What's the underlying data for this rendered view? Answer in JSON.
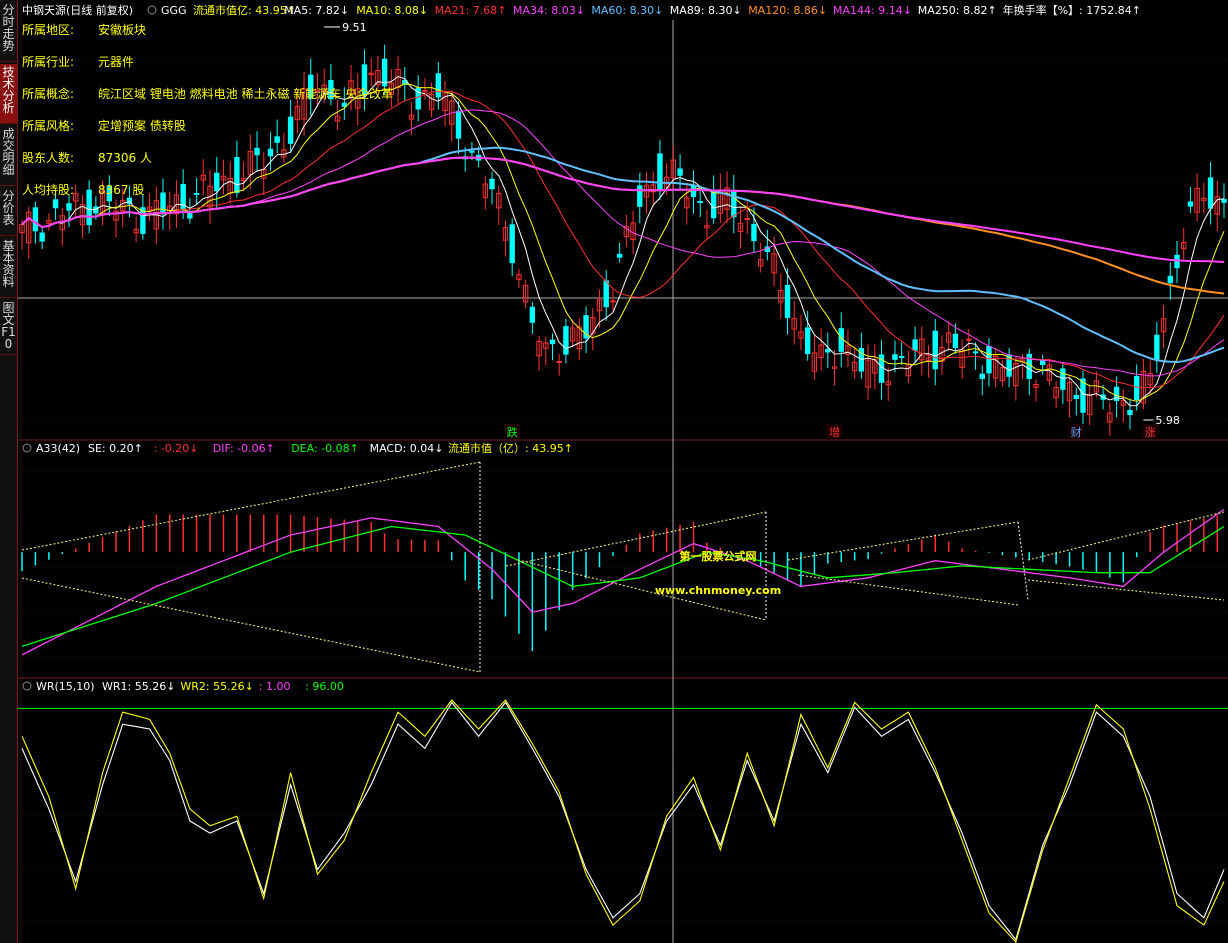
{
  "sidebar": {
    "tabs": [
      {
        "label": "分时走势",
        "active": false
      },
      {
        "label": "技术分析",
        "active": true
      },
      {
        "label": "成交明细",
        "active": false
      },
      {
        "label": "分价表",
        "active": false
      },
      {
        "label": "基本资料",
        "active": false
      },
      {
        "label": "图文F10",
        "active": false
      }
    ]
  },
  "header": {
    "stock": "中钢天源(日线 前复权)",
    "indicator": "GGG",
    "items": [
      {
        "text": "流通市值亿: 43.95↑",
        "color": "#ffff00"
      },
      {
        "text": "MA5: 7.82↓",
        "color": "#ffffff"
      },
      {
        "text": "MA10: 8.08↓",
        "color": "#ffff00"
      },
      {
        "text": "MA21: 7.68↑",
        "color": "#ff3030"
      },
      {
        "text": "MA34: 8.03↓",
        "color": "#ff40ff"
      },
      {
        "text": "MA60: 8.30↓",
        "color": "#60c0ff"
      },
      {
        "text": "MA89: 8.30↓",
        "color": "#ffffff"
      },
      {
        "text": "MA120: 8.86↓",
        "color": "#ff9020"
      },
      {
        "text": "MA144: 9.14↓",
        "color": "#ff40ff"
      },
      {
        "text": "MA250: 8.82↑",
        "color": "#ffffff"
      },
      {
        "text": "年换手率【%】: 1752.84↑",
        "color": "#ffffff"
      }
    ]
  },
  "info_panel": [
    {
      "label": "所属地区:",
      "value": "安徽板块"
    },
    {
      "label": "所属行业:",
      "value": "元器件"
    },
    {
      "label": "所属概念:",
      "value": "皖江区域 锂电池 燃料电池 稀土永磁 新能源车 央企改革"
    },
    {
      "label": "所属风格:",
      "value": "定增预案 债转股"
    },
    {
      "label": "股东人数:",
      "value": "87306    人"
    },
    {
      "label": "人均持股:",
      "value": "8367     股"
    }
  ],
  "price_annotations": {
    "high": "9.51",
    "low": "5.98"
  },
  "signal_labels": [
    {
      "text": "跌",
      "color": "#00ff00",
      "index": 73
    },
    {
      "text": "增",
      "color": "#ff3030",
      "index": 121
    },
    {
      "text": "财",
      "color": "#60a0ff",
      "index": 157
    },
    {
      "text": "涨",
      "color": "#ff3030",
      "index": 168
    }
  ],
  "macd_header": {
    "title": "A33(42)",
    "items": [
      {
        "text": "SE: 0.20↑",
        "color": "#ffffff"
      },
      {
        "text": ": -0.20↓",
        "color": "#ff3030"
      },
      {
        "text": "DIF: -0.06↑",
        "color": "#ff40ff"
      },
      {
        "text": "DEA: -0.08↑",
        "color": "#00ff00"
      },
      {
        "text": "MACD: 0.04↓",
        "color": "#ffffff"
      },
      {
        "text": "流通市值（亿）: 43.95↑",
        "color": "#ffff00"
      }
    ]
  },
  "wr_header": {
    "title": "WR(15,10)",
    "items": [
      {
        "text": "WR1: 55.26↓",
        "color": "#ffffff"
      },
      {
        "text": "WR2: 55.26↓",
        "color": "#ffff00"
      },
      {
        "text": ": 1.00",
        "color": "#ff40ff"
      },
      {
        "text": ": 96.00",
        "color": "#00ff00"
      }
    ]
  },
  "watermark": {
    "line1": "第一股票公式网",
    "line2": "www.chnmoney.com"
  },
  "colors": {
    "up": "#ff3030",
    "down": "#00ffff",
    "bg": "#000000",
    "grid": "#7a1a1a"
  },
  "chart_data": {
    "type": "candlestick",
    "title": "中钢天源(日线 前复权)",
    "candles_count": 180,
    "price_range": [
      5.7,
      9.7
    ],
    "key_points": [
      {
        "index": 45,
        "price": 9.51,
        "label": "high"
      },
      {
        "index": 167,
        "price": 5.98,
        "label": "low"
      }
    ],
    "ma_series": [
      {
        "name": "MA5",
        "last": 7.82,
        "color": "#ffffff"
      },
      {
        "name": "MA10",
        "last": 8.08,
        "color": "#ffff00"
      },
      {
        "name": "MA21",
        "last": 7.68,
        "color": "#ff3030"
      },
      {
        "name": "MA34",
        "last": 8.03,
        "color": "#ff40ff"
      },
      {
        "name": "MA60",
        "last": 8.3,
        "color": "#60c0ff"
      },
      {
        "name": "MA120",
        "last": 8.86,
        "color": "#ff9020"
      },
      {
        "name": "MA144",
        "last": 9.14,
        "color": "#ff40ff"
      }
    ],
    "close_path": [
      [
        0,
        7.6
      ],
      [
        6,
        7.8
      ],
      [
        12,
        7.9
      ],
      [
        18,
        7.75
      ],
      [
        24,
        7.9
      ],
      [
        30,
        8.1
      ],
      [
        36,
        8.3
      ],
      [
        40,
        8.6
      ],
      [
        44,
        9.1
      ],
      [
        48,
        8.8
      ],
      [
        52,
        9.2
      ],
      [
        55,
        9.1
      ],
      [
        58,
        8.9
      ],
      [
        62,
        9.0
      ],
      [
        66,
        8.5
      ],
      [
        70,
        8.0
      ],
      [
        73,
        7.5
      ],
      [
        76,
        6.7
      ],
      [
        78,
        6.4
      ],
      [
        80,
        6.5
      ],
      [
        84,
        6.6
      ],
      [
        88,
        7.1
      ],
      [
        92,
        7.9
      ],
      [
        95,
        8.2
      ],
      [
        98,
        8.1
      ],
      [
        102,
        7.8
      ],
      [
        105,
        7.9
      ],
      [
        108,
        7.7
      ],
      [
        112,
        7.2
      ],
      [
        116,
        6.6
      ],
      [
        119,
        6.3
      ],
      [
        122,
        6.5
      ],
      [
        126,
        6.2
      ],
      [
        130,
        6.3
      ],
      [
        134,
        6.4
      ],
      [
        138,
        6.5
      ],
      [
        142,
        6.4
      ],
      [
        146,
        6.2
      ],
      [
        150,
        6.3
      ],
      [
        154,
        6.1
      ],
      [
        158,
        6.0
      ],
      [
        162,
        5.9
      ],
      [
        165,
        5.95
      ],
      [
        168,
        6.1
      ],
      [
        170,
        6.8
      ],
      [
        173,
        7.6
      ],
      [
        176,
        8.0
      ],
      [
        179,
        7.9
      ]
    ],
    "macd": {
      "dif_last": -0.06,
      "dea_last": -0.08,
      "macd_last": 0.04,
      "dif_path": [
        [
          0,
          -0.6
        ],
        [
          20,
          -0.2
        ],
        [
          40,
          0.1
        ],
        [
          52,
          0.2
        ],
        [
          62,
          0.15
        ],
        [
          70,
          -0.1
        ],
        [
          76,
          -0.35
        ],
        [
          82,
          -0.3
        ],
        [
          92,
          -0.1
        ],
        [
          100,
          0.05
        ],
        [
          108,
          -0.05
        ],
        [
          116,
          -0.2
        ],
        [
          126,
          -0.15
        ],
        [
          136,
          -0.05
        ],
        [
          146,
          -0.1
        ],
        [
          156,
          -0.15
        ],
        [
          164,
          -0.2
        ],
        [
          170,
          0.0
        ],
        [
          179,
          0.25
        ]
      ],
      "dea_path": [
        [
          0,
          -0.55
        ],
        [
          20,
          -0.3
        ],
        [
          40,
          0.0
        ],
        [
          55,
          0.15
        ],
        [
          66,
          0.1
        ],
        [
          74,
          -0.05
        ],
        [
          82,
          -0.2
        ],
        [
          92,
          -0.15
        ],
        [
          102,
          0.0
        ],
        [
          110,
          -0.05
        ],
        [
          120,
          -0.15
        ],
        [
          130,
          -0.12
        ],
        [
          140,
          -0.08
        ],
        [
          150,
          -0.1
        ],
        [
          160,
          -0.12
        ],
        [
          168,
          -0.12
        ],
        [
          179,
          0.15
        ]
      ]
    },
    "wr": {
      "wr1_last": 55.26,
      "wr2_last": 55.26,
      "upper": 1.0,
      "lower": 96.0,
      "ylim": [
        0,
        100
      ],
      "wr1_path": [
        [
          0,
          20
        ],
        [
          4,
          45
        ],
        [
          8,
          75
        ],
        [
          12,
          35
        ],
        [
          15,
          10
        ],
        [
          19,
          12
        ],
        [
          22,
          25
        ],
        [
          25,
          50
        ],
        [
          28,
          55
        ],
        [
          32,
          50
        ],
        [
          36,
          80
        ],
        [
          40,
          35
        ],
        [
          44,
          70
        ],
        [
          48,
          55
        ],
        [
          52,
          35
        ],
        [
          56,
          10
        ],
        [
          60,
          20
        ],
        [
          64,
          1
        ],
        [
          68,
          15
        ],
        [
          72,
          1
        ],
        [
          76,
          20
        ],
        [
          80,
          40
        ],
        [
          84,
          70
        ],
        [
          88,
          90
        ],
        [
          92,
          80
        ],
        [
          96,
          50
        ],
        [
          100,
          35
        ],
        [
          104,
          60
        ],
        [
          108,
          25
        ],
        [
          112,
          50
        ],
        [
          116,
          10
        ],
        [
          120,
          30
        ],
        [
          124,
          3
        ],
        [
          128,
          15
        ],
        [
          132,
          8
        ],
        [
          136,
          30
        ],
        [
          140,
          55
        ],
        [
          144,
          85
        ],
        [
          148,
          99
        ],
        [
          152,
          60
        ],
        [
          156,
          35
        ],
        [
          160,
          5
        ],
        [
          164,
          15
        ],
        [
          168,
          40
        ],
        [
          172,
          80
        ],
        [
          176,
          90
        ],
        [
          179,
          70
        ]
      ],
      "wr2_path": [
        [
          0,
          15
        ],
        [
          4,
          40
        ],
        [
          8,
          78
        ],
        [
          12,
          30
        ],
        [
          15,
          5
        ],
        [
          19,
          8
        ],
        [
          22,
          22
        ],
        [
          25,
          45
        ],
        [
          28,
          52
        ],
        [
          32,
          48
        ],
        [
          36,
          82
        ],
        [
          40,
          30
        ],
        [
          44,
          72
        ],
        [
          48,
          58
        ],
        [
          52,
          30
        ],
        [
          56,
          5
        ],
        [
          60,
          15
        ],
        [
          64,
          0
        ],
        [
          68,
          12
        ],
        [
          72,
          0
        ],
        [
          76,
          18
        ],
        [
          80,
          38
        ],
        [
          84,
          72
        ],
        [
          88,
          93
        ],
        [
          92,
          83
        ],
        [
          96,
          48
        ],
        [
          100,
          32
        ],
        [
          104,
          62
        ],
        [
          108,
          22
        ],
        [
          112,
          52
        ],
        [
          116,
          6
        ],
        [
          120,
          28
        ],
        [
          124,
          1
        ],
        [
          128,
          12
        ],
        [
          132,
          5
        ],
        [
          136,
          28
        ],
        [
          140,
          58
        ],
        [
          144,
          88
        ],
        [
          148,
          100
        ],
        [
          152,
          62
        ],
        [
          156,
          32
        ],
        [
          160,
          2
        ],
        [
          164,
          12
        ],
        [
          168,
          45
        ],
        [
          172,
          85
        ],
        [
          176,
          93
        ],
        [
          179,
          75
        ]
      ]
    }
  }
}
